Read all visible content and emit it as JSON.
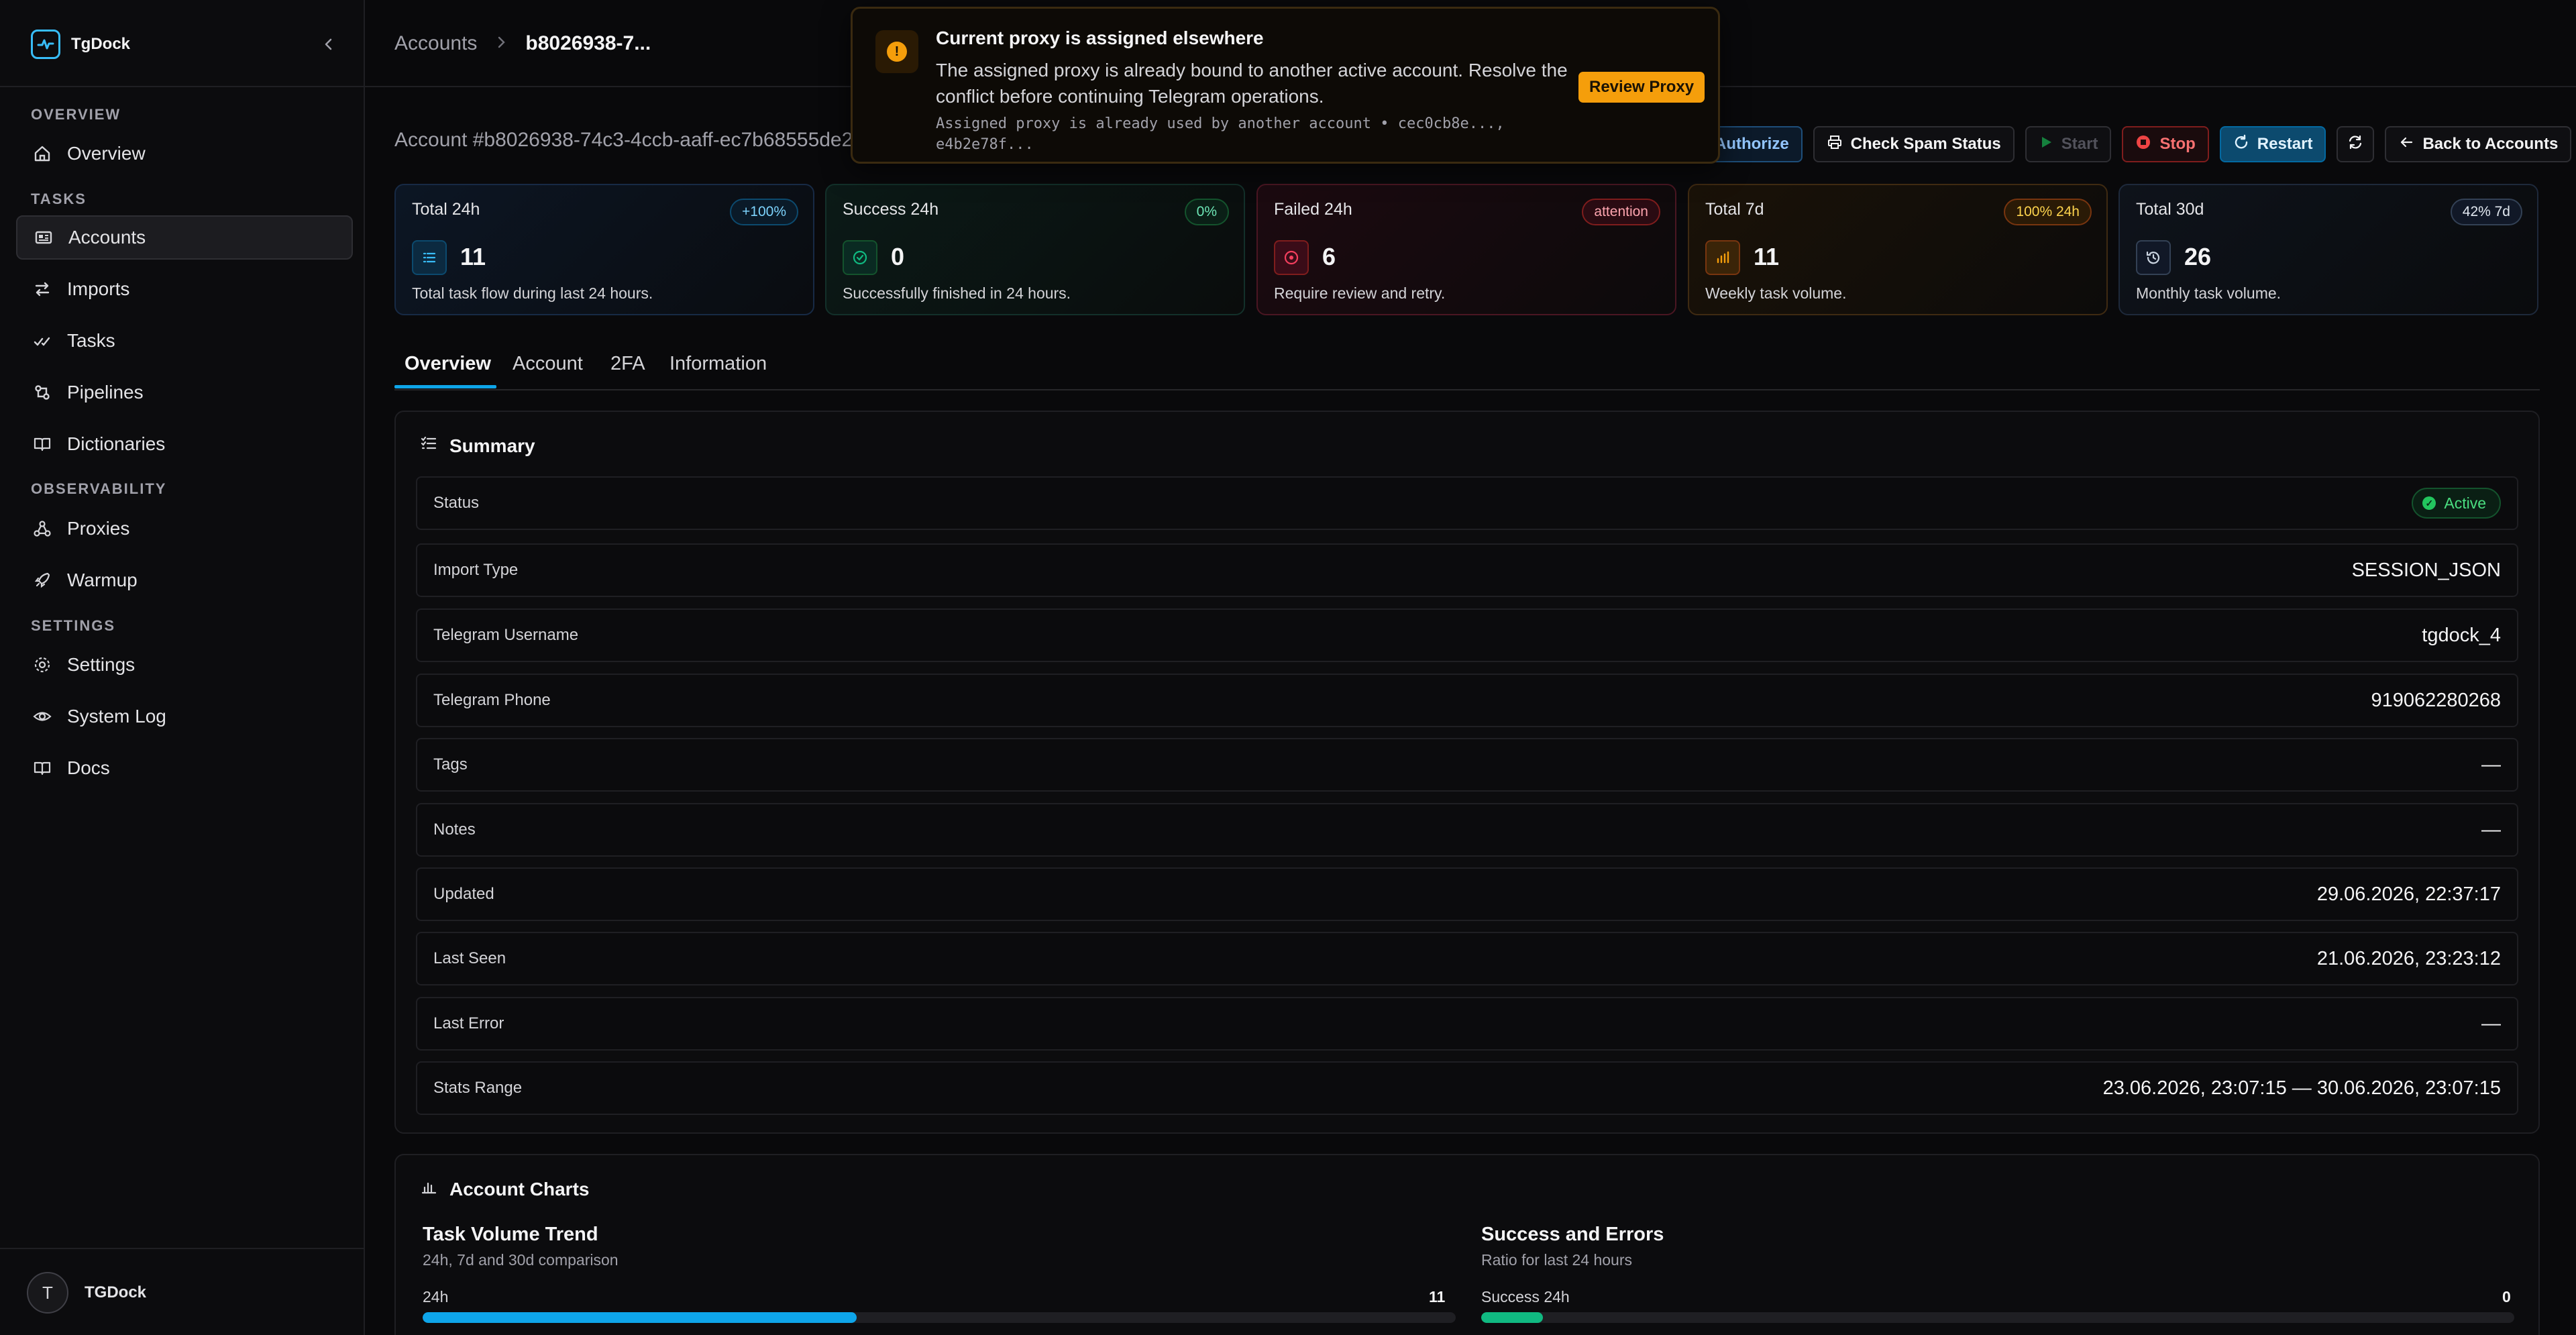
{
  "app": {
    "name": "TgDock"
  },
  "sidebar": {
    "sections": [
      {
        "label": "OVERVIEW"
      },
      {
        "label": "TASKS"
      },
      {
        "label": "OBSERVABILITY"
      },
      {
        "label": "SETTINGS"
      }
    ],
    "items": [
      {
        "label": "Overview",
        "icon": "home-icon"
      },
      {
        "label": "Accounts",
        "icon": "accounts-icon"
      },
      {
        "label": "Imports",
        "icon": "imports-icon"
      },
      {
        "label": "Tasks",
        "icon": "tasks-icon"
      },
      {
        "label": "Pipelines",
        "icon": "pipelines-icon"
      },
      {
        "label": "Dictionaries",
        "icon": "book-icon"
      },
      {
        "label": "Proxies",
        "icon": "proxies-icon"
      },
      {
        "label": "Warmup",
        "icon": "rocket-icon"
      },
      {
        "label": "Settings",
        "icon": "gear-icon"
      },
      {
        "label": "System Log",
        "icon": "eye-icon"
      },
      {
        "label": "Docs",
        "icon": "book-icon"
      }
    ],
    "user": {
      "initial": "T",
      "name": "TGDock"
    }
  },
  "breadcrumb": {
    "parent": "Accounts",
    "current": "b8026938-7..."
  },
  "account": {
    "id_text": "Account #b8026938-74c3-4ccb-aaff-ec7b68555de2"
  },
  "toolbar": {
    "authorize": "Authorize",
    "spam": "Check Spam Status",
    "start": "Start",
    "stop": "Stop",
    "restart": "Restart",
    "back": "Back to Accounts"
  },
  "toast": {
    "title": "Current proxy is assigned elsewhere",
    "body": "The assigned proxy is already bound to another active account. Resolve the conflict before continuing Telegram operations.",
    "detail_line1": "Assigned proxy is already used by another account • cec0cb8e...,",
    "detail_line2": "e4b2e78f...",
    "button": "Review Proxy"
  },
  "stats": [
    {
      "label": "Total 24h",
      "badge": "+100%",
      "value": "11",
      "desc": "Total task flow during last 24 hours.",
      "icon": "list-icon",
      "color": "#0ea5e9"
    },
    {
      "label": "Success 24h",
      "badge": "0%",
      "value": "0",
      "desc": "Successfully finished in 24 hours.",
      "icon": "check-circle-icon",
      "color": "#10b981"
    },
    {
      "label": "Failed 24h",
      "badge": "attention",
      "value": "6",
      "desc": "Require review and retry.",
      "icon": "alert-icon",
      "color": "#f43f5e"
    },
    {
      "label": "Total 7d",
      "badge": "100% 24h",
      "value": "11",
      "desc": "Weekly task volume.",
      "icon": "bar-chart-icon",
      "color": "#f59e0b"
    },
    {
      "label": "Total 30d",
      "badge": "42% 7d",
      "value": "26",
      "desc": "Monthly task volume.",
      "icon": "history-icon",
      "color": "#94a3b8"
    }
  ],
  "tabs": [
    {
      "label": "Overview"
    },
    {
      "label": "Account"
    },
    {
      "label": "2FA"
    },
    {
      "label": "Information"
    }
  ],
  "summary": {
    "title": "Summary",
    "rows": [
      {
        "label": "Status",
        "value": "Active"
      },
      {
        "label": "Import Type",
        "value": "SESSION_JSON"
      },
      {
        "label": "Telegram Username",
        "value": "tgdock_4"
      },
      {
        "label": "Telegram Phone",
        "value": "919062280268"
      },
      {
        "label": "Tags",
        "value": "—"
      },
      {
        "label": "Notes",
        "value": "—"
      },
      {
        "label": "Updated",
        "value": "29.06.2026, 22:37:17"
      },
      {
        "label": "Last Seen",
        "value": "21.06.2026, 23:23:12"
      },
      {
        "label": "Last Error",
        "value": "—"
      },
      {
        "label": "Stats Range",
        "value": "23.06.2026, 23:07:15 — 30.06.2026, 23:07:15"
      }
    ]
  },
  "charts": {
    "title": "Account Charts",
    "trend": {
      "title": "Task Volume Trend",
      "subtitle": "24h, 7d and 30d comparison",
      "bar_label": "24h",
      "bar_value": "11",
      "fraction": 0.42,
      "color": "#0ea5e9"
    },
    "ratio": {
      "title": "Success and Errors",
      "subtitle": "Ratio for last 24 hours",
      "bar_label": "Success 24h",
      "bar_value": "0",
      "fraction": 0.06,
      "color": "#10b981"
    }
  }
}
